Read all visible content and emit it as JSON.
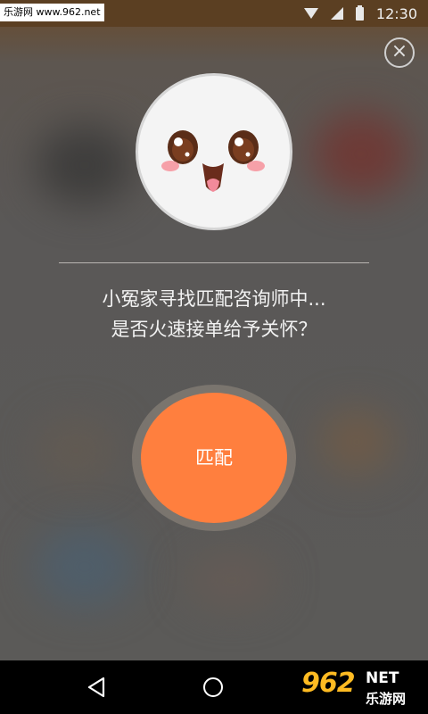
{
  "status_bar": {
    "watermark": "乐游网 www.962.net",
    "time": "12:30"
  },
  "dialog": {
    "close_symbol": "×",
    "message_line1": "小冤家寻找匹配咨询师中...",
    "message_line2": "是否火速接单给予关怀？",
    "match_button_label": "匹配"
  },
  "logo": {
    "number": "962",
    "net": "NET",
    "chinese": "乐游网"
  },
  "icons": {
    "close": "close-icon",
    "back": "back-icon",
    "home": "home-icon",
    "wifi": "wifi-icon",
    "signal": "signal-icon",
    "battery": "battery-icon"
  },
  "colors": {
    "accent": "#ff7f3e",
    "overlay": "#5a5753"
  }
}
